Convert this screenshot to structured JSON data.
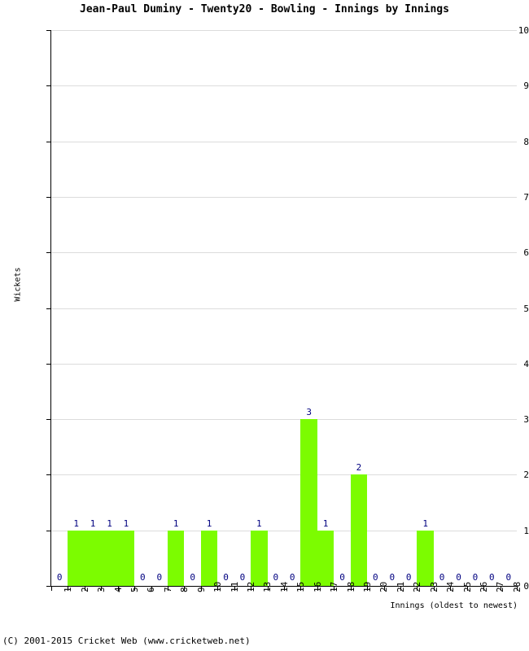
{
  "chart_data": {
    "type": "bar",
    "title": "Jean-Paul Duminy - Twenty20 - Bowling - Innings by Innings",
    "xlabel": "Innings (oldest to newest)",
    "ylabel": "Wickets",
    "categories": [
      "1",
      "2",
      "3",
      "4",
      "5",
      "6",
      "7",
      "8",
      "9",
      "10",
      "11",
      "12",
      "13",
      "14",
      "15",
      "16",
      "17",
      "18",
      "19",
      "20",
      "21",
      "22",
      "23",
      "24",
      "25",
      "26",
      "27",
      "28"
    ],
    "values": [
      0,
      1,
      1,
      1,
      1,
      0,
      0,
      1,
      0,
      1,
      0,
      0,
      1,
      0,
      0,
      3,
      1,
      0,
      2,
      0,
      0,
      0,
      1,
      0,
      0,
      0,
      0,
      0
    ],
    "ylim": [
      0,
      10
    ],
    "yticks": [
      "0",
      "1",
      "2",
      "3",
      "4",
      "5",
      "6",
      "7",
      "8",
      "9",
      "10"
    ],
    "grid": true,
    "legend": false,
    "bar_color": "#7cfc00",
    "label_color": "#000080",
    "grid_color": "#dcdcdc",
    "axis_color": "#000000"
  },
  "footer": {
    "copyright": "(C) 2001-2015 Cricket Web (www.cricketweb.net)"
  }
}
